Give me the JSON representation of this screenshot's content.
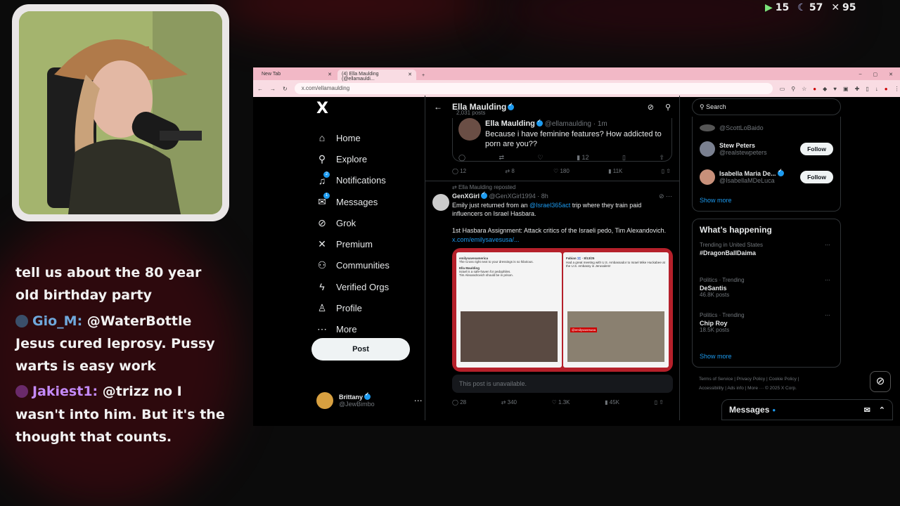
{
  "stream": {
    "stats": [
      {
        "icon": "play-icon",
        "value": "15"
      },
      {
        "icon": "moon-icon",
        "value": "57"
      },
      {
        "icon": "x-icon",
        "value": "95"
      }
    ],
    "chat": [
      {
        "user": "",
        "text": "tell us about the 80 year old birthday party"
      },
      {
        "user": "Gio_M:",
        "text": "@WaterBottle Jesus cured leprosy.  Pussy warts is easy work"
      },
      {
        "user": "Jakiest1:",
        "text": "@trizz no I wasn't into him. But it's the thought that counts."
      }
    ]
  },
  "browser": {
    "tabs": [
      {
        "label": "New Tab",
        "active": false
      },
      {
        "label": "(4) Ella Maulding (@ellamauldi...",
        "active": true
      }
    ],
    "url": "x.com/ellamaulding"
  },
  "nav": {
    "logo": "X",
    "items": [
      {
        "icon": "home-icon",
        "glyph": "⌂",
        "label": "Home"
      },
      {
        "icon": "explore-icon",
        "glyph": "⚲",
        "label": "Explore"
      },
      {
        "icon": "bell-icon",
        "glyph": "🔔",
        "label": "Notifications",
        "badge": "2"
      },
      {
        "icon": "mail-icon",
        "glyph": "✉",
        "label": "Messages",
        "badge": "1"
      },
      {
        "icon": "grok-icon",
        "glyph": "⊘",
        "label": "Grok"
      },
      {
        "icon": "x-premium-icon",
        "glyph": "✕",
        "label": "Premium"
      },
      {
        "icon": "communities-icon",
        "glyph": "⚇",
        "label": "Communities"
      },
      {
        "icon": "bolt-icon",
        "glyph": "ϟ",
        "label": "Verified Orgs"
      },
      {
        "icon": "profile-icon",
        "glyph": "♙",
        "label": "Profile"
      },
      {
        "icon": "more-icon",
        "glyph": "⋯",
        "label": "More"
      }
    ],
    "post_label": "Post",
    "account": {
      "name": "Brittany",
      "handle": "@JewBimbo"
    }
  },
  "feed": {
    "header": {
      "name": "Ella Maulding",
      "posts": "2,031 posts"
    },
    "quote": {
      "name": "Ella Maulding",
      "handle": "@ellamaulding · 1m",
      "text": "Because i have feminine features? How addicted to porn are you??",
      "stats": [
        "",
        "",
        "",
        "12",
        "",
        ""
      ]
    },
    "tweet1_actions": [
      "12",
      "8",
      "180",
      "11K"
    ],
    "tweet2": {
      "reposted": "Ella Maulding reposted",
      "name": "GenXGirl",
      "handle": "@GenXGirl1994 · 8h",
      "text_a": "Emily just returned from an ",
      "mention": "@Israel365act",
      "text_b": " trip where they train paid influencers on Israel Hasbara.",
      "text_c": "1st Hasbara Assignment: Attack critics of the Israeli pedo, Tim Alexandovich. ",
      "link": "x.com/emilysavesusa/...",
      "card1": {
        "author": "emilysavesamerica",
        "line1": "The Cross right next to your dressings is so hilarious.",
        "quoted": "Ella Maulding",
        "line2": "Israel is a safe-haven for pedophiles.",
        "line3": "Tim Alexandrovich should be in prison."
      },
      "card2": {
        "author": "Fabian 🇮🇱 · 8/13/25",
        "line1": "Had a great meeting with U.S. Ambassador to Israel Mike Huckabee at the U.S. embassy in Jerusalem!",
        "tag": "@emilysavesusa"
      },
      "unavailable": "This post is unavailable.",
      "actions": [
        "28",
        "340",
        "1.3K",
        "45K"
      ]
    }
  },
  "sidebar": {
    "search_placeholder": "Search",
    "who_to_follow": [
      {
        "name": "",
        "handle": "@ScottLoBaido"
      },
      {
        "name": "Stew Peters",
        "handle": "@realstewpeters",
        "button": "Follow"
      },
      {
        "name": "Isabella Maria De...",
        "handle": "@IsabellaMDeLuca",
        "button": "Follow"
      }
    ],
    "show_more": "Show more",
    "happening_title": "What’s happening",
    "trends": [
      {
        "context": "Trending in United States",
        "name": "#DragonBallDaima",
        "count": ""
      },
      {
        "context": "Politics · Trending",
        "name": "DeSantis",
        "count": "46.8K posts"
      },
      {
        "context": "Politics · Trending",
        "name": "Chip Roy",
        "count": "18.5K posts"
      }
    ],
    "footer_line1": "Terms of Service  |  Privacy Policy  |  Cookie Policy  |",
    "footer_line2": "Accessibility  |  Ads info  |  More ···  © 2025 X Corp.",
    "messages_label": "Messages"
  }
}
